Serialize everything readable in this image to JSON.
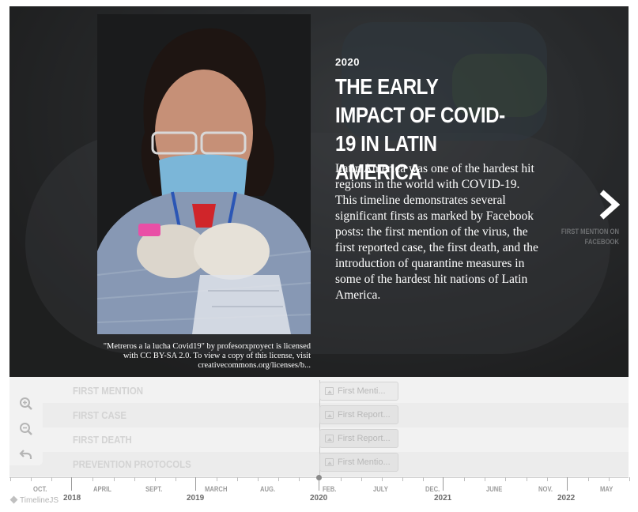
{
  "slide": {
    "year": "2020",
    "headline": "THE EARLY IMPACT OF COVID-19 IN LATIN AMERICA",
    "description": "Latin America was one of the hardest hit regions in the world with COVID-19. This timeline demonstrates several significant firsts as marked by Facebook posts: the first mention of the virus, the first reported case, the first death, and the introduction of quarantine measures in some of the hardest hit nations of Latin America.",
    "image_credit": "\"Metreros a la lucha Covid19\" by profesorxproyect is licensed with CC BY-SA 2.0. To view a copy of this license, visit creativecommons.org/licenses/b...",
    "next_label": "FIRST MENTION ON FACEBOOK"
  },
  "timenav": {
    "groups": [
      "FIRST MENTION",
      "FIRST CASE",
      "FIRST DEATH",
      "PREVENTION PROTOCOLS"
    ],
    "markers": [
      "First Menti...",
      "First Report...",
      "First Report...",
      "First Mentio..."
    ]
  },
  "axis": {
    "tick_labels": [
      "OCT.",
      "APRIL",
      "SEPT.",
      "MARCH",
      "AUG.",
      "FEB.",
      "JULY",
      "DEC.",
      "JUNE",
      "NOV.",
      "MAY"
    ],
    "year_labels": [
      "2018",
      "2019",
      "2020",
      "2021",
      "2022"
    ]
  },
  "branding": "TimelineJS",
  "icons": {
    "zoom_in": "zoom-in-icon",
    "zoom_out": "zoom-out-icon",
    "back_to_start": "back-arrow-icon",
    "next": "chevron-right-icon",
    "marker_media": "image-icon"
  },
  "colors": {
    "slide_bg": "#2a2b2c",
    "timenav_bg": "#f2f2f2",
    "text_light": "#ffffff"
  }
}
